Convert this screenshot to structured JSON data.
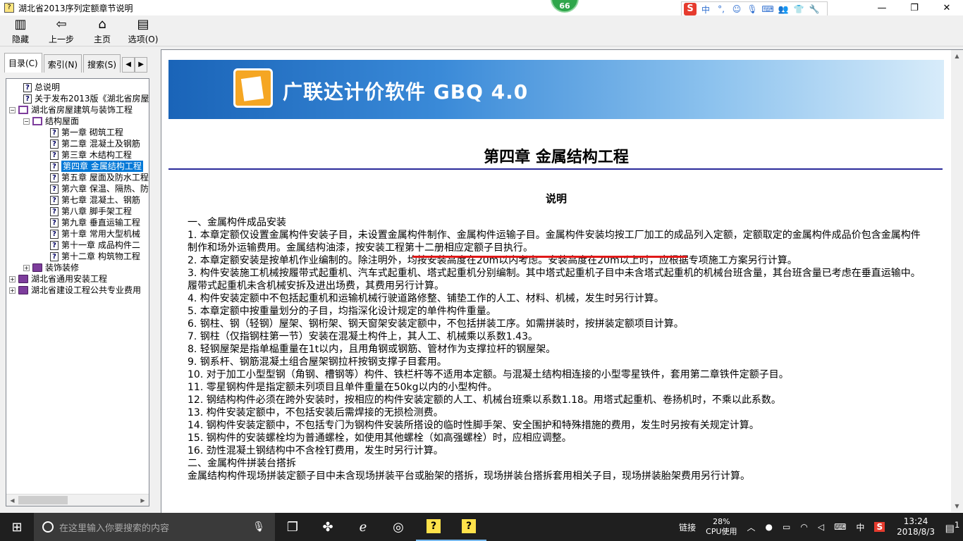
{
  "window": {
    "title": "湖北省2013序列定额章节说明",
    "badge": "66"
  },
  "ime_bar": {
    "logo": "S",
    "items": [
      "中",
      "°,",
      "☺",
      "🎙",
      "⌨",
      "👥",
      "👕",
      "🔧"
    ]
  },
  "toolbar": {
    "buttons": [
      {
        "label": "隐藏",
        "icon": "hide-icon"
      },
      {
        "label": "上一步",
        "icon": "back-arrow-icon"
      },
      {
        "label": "主页",
        "icon": "home-icon"
      },
      {
        "label": "选项(O)",
        "icon": "options-icon"
      }
    ]
  },
  "tabs": [
    "目录(C)",
    "索引(N)",
    "搜索(S)"
  ],
  "tree": [
    {
      "label": "总说明",
      "level": 1,
      "icon": "q"
    },
    {
      "label": "关于发布2013版《湖北省房屋",
      "level": 1,
      "icon": "q"
    },
    {
      "label": "湖北省房屋建筑与装饰工程",
      "level": 0,
      "icon": "bookopen",
      "exp": "−"
    },
    {
      "label": "结构屋面",
      "level": 1,
      "icon": "bookopen",
      "exp": "−"
    },
    {
      "label": "第一章 砌筑工程",
      "level": 2,
      "icon": "q"
    },
    {
      "label": "第二章 混凝土及钢筋",
      "level": 2,
      "icon": "q"
    },
    {
      "label": "第三章 木结构工程",
      "level": 2,
      "icon": "q"
    },
    {
      "label": "第四章 金属结构工程",
      "level": 2,
      "icon": "q",
      "selected": true
    },
    {
      "label": "第五章 屋面及防水工程",
      "level": 2,
      "icon": "q"
    },
    {
      "label": "第六章 保温、隔热、防",
      "level": 2,
      "icon": "q"
    },
    {
      "label": "第七章 混凝土、钢筋",
      "level": 2,
      "icon": "q"
    },
    {
      "label": "第八章 脚手架工程",
      "level": 2,
      "icon": "q"
    },
    {
      "label": "第九章 垂直运输工程",
      "level": 2,
      "icon": "q"
    },
    {
      "label": "第十章 常用大型机械",
      "level": 2,
      "icon": "q"
    },
    {
      "label": "第十一章 成品构件二",
      "level": 2,
      "icon": "q"
    },
    {
      "label": "第十二章 构筑物工程",
      "level": 2,
      "icon": "q"
    },
    {
      "label": "装饰装修",
      "level": 1,
      "icon": "book",
      "exp": "+"
    },
    {
      "label": "湖北省通用安装工程",
      "level": 0,
      "icon": "book",
      "exp": "+"
    },
    {
      "label": "湖北省建设工程公共专业费用",
      "level": 0,
      "icon": "book",
      "exp": "+"
    }
  ],
  "banner": {
    "title": "广联达计价软件 GBQ 4.0"
  },
  "content": {
    "chapter": "第四章  金属结构工程",
    "subtitle": "说明",
    "lines": [
      "一、金属构件成品安装",
      "1. 本章定额仅设置金属构件安装子目，未设置金属构件制作、金属构件运输子目。金属构件安装均按工厂加工的成品列入定额，定额取定的金属构件成品价包含金属构件制作和场外运输费用。金属结构油漆，按安装工程第十二册相应定额子目执行。",
      "2. 本章定额安装是按单机作业编制的。除注明外，均按安装高度在20m以内考虑。安装高度在20m以上时，应根据专项施工方案另行计算。",
      "3. 构件安装施工机械按履带式起重机、汽车式起重机、塔式起重机分别编制。其中塔式起重机子目中未含塔式起重机的机械台班含量，其台班含量已考虑在垂直运输中。履带式起重机未含机械安拆及进出场费，其费用另行计算。",
      "4. 构件安装定额中不包括起重机和运输机械行驶道路修整、铺垫工作的人工、材料、机械，发生时另行计算。",
      "5. 本章定额中按重量划分的子目，均指深化设计规定的单件构件重量。",
      "6. 钢柱、钢（轻钢）屋架、钢桁架、钢天窗架安装定额中，不包括拼装工序。如需拼装时，按拼装定额项目计算。",
      "7. 钢柱（仅指钢柱第一节）安装在混凝土构件上，其人工、机械乘以系数1.43。",
      "8. 轻钢屋架是指单榀重量在1t以内，且用角钢或钢筋、管材作为支撑拉杆的钢屋架。",
      "9. 钢系杆、钢筋混凝土组合屋架钢拉杆按钢支撑子目套用。",
      "10. 对于加工小型型钢（角钢、槽钢等）构件、铁栏杆等不适用本定额。与混凝土结构相连接的小型零星铁件，套用第二章铁件定额子目。",
      "11. 零星钢构件是指定额未列项目且单件重量在50kg以内的小型构件。",
      "12. 钢结构构件必须在跨外安装时，按相应的构件安装定额的人工、机械台班乘以系数1.18。用塔式起重机、卷扬机时，不乘以此系数。",
      "13. 构件安装定额中，不包括安装后需焊接的无损检测费。",
      "14. 钢构件安装定额中，不包括专门为钢构件安装所搭设的临时性脚手架、安全围护和特殊措施的费用，发生时另按有关规定计算。",
      "15. 钢构件的安装螺栓均为普通螺栓，如使用其他螺栓（如高强螺栓）时，应相应调整。",
      "16. 劲性混凝土钢结构中不含栓钉费用，发生时另行计算。",
      "二、金属构件拼装台搭拆",
      "金属结构构件现场拼装定额子目中未含现场拼装平台或胎架的搭拆，现场拼装台搭拆套用相关子目，现场拼装胎架费用另行计算。"
    ]
  },
  "taskbar": {
    "search_placeholder": "在这里输入你要搜索的内容",
    "link_label": "链接",
    "cpu_percent": "28%",
    "cpu_label": "CPU使用",
    "ime_label": "中",
    "time": "13:24",
    "date": "2018/8/3",
    "notif_count": "1"
  },
  "colors": {
    "selection": "#0078d7",
    "underline_red": "#e01818",
    "rule_blue": "#2a2a9a"
  }
}
